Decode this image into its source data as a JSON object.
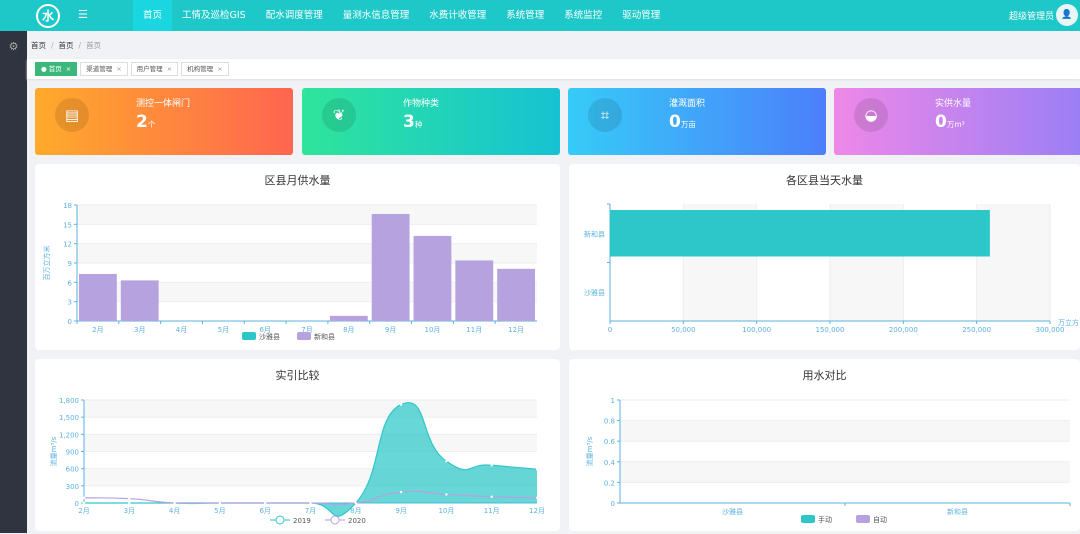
{
  "header": {
    "logo": "水",
    "menu_icon": "indent-icon",
    "nav": [
      "首页",
      "工情及巡检GIS",
      "配水调度管理",
      "量测水信息管理",
      "水费计收管理",
      "系统管理",
      "系统监控",
      "驱动管理"
    ],
    "user": "超级管理员"
  },
  "sidebar": {
    "icon": "gear-icon"
  },
  "breadcrumb": [
    "首页",
    "首页",
    "首页"
  ],
  "tabs": [
    {
      "label": "首页",
      "close": "×"
    },
    {
      "label": "渠道管理",
      "close": "×"
    },
    {
      "label": "用户管理",
      "close": "×"
    },
    {
      "label": "机构管理",
      "close": "×"
    }
  ],
  "cards": [
    {
      "label": "测控一体闸门",
      "value": "2",
      "unit": "个",
      "icon": "gate-icon",
      "colors": [
        "#ffaa2b",
        "#ff6650"
      ]
    },
    {
      "label": "作物种类",
      "value": "3",
      "unit": "种",
      "icon": "leaf-icon",
      "colors": [
        "#2fe59b",
        "#16c2d3"
      ]
    },
    {
      "label": "灌溉面积",
      "value": "0",
      "unit": "万亩",
      "icon": "area-icon",
      "colors": [
        "#36cbf8",
        "#4c7ffb"
      ]
    },
    {
      "label": "实供水量",
      "value": "0",
      "unit": "万m³",
      "icon": "water-bucket-icon",
      "colors": [
        "#ee88e8",
        "#9a7ff5"
      ]
    }
  ],
  "chart_data": [
    {
      "type": "bar",
      "title": "区县月供水量",
      "ylabel": "百万立方米",
      "ylim": [
        0,
        18
      ],
      "yticks": [
        "0",
        "3",
        "6",
        "9",
        "12",
        "15",
        "18"
      ],
      "categories": [
        "2月",
        "3月",
        "4月",
        "5月",
        "6月",
        "7月",
        "8月",
        "9月",
        "10月",
        "11月",
        "12月"
      ],
      "series": [
        {
          "name": "沙雅县",
          "color": "#2ec7c9",
          "values": [
            0,
            0,
            0,
            0,
            0,
            0,
            0,
            0,
            0,
            0,
            0
          ]
        },
        {
          "name": "新和县",
          "color": "#b6a2de",
          "values": [
            7.3,
            6.3,
            0,
            0,
            0,
            0,
            0.8,
            16.6,
            13.2,
            9.4,
            8.1
          ]
        }
      ]
    },
    {
      "type": "bar",
      "orientation": "horizontal",
      "title": "各区县当天水量",
      "xlabel": "万立方",
      "xlim": [
        0,
        300000
      ],
      "xticks": [
        "0",
        "50,000",
        "100,000",
        "150,000",
        "200,000",
        "250,000",
        "300,000"
      ],
      "categories": [
        "新和县",
        "沙雅县"
      ],
      "values": [
        259000,
        0
      ],
      "color": "#2ec7c9"
    },
    {
      "type": "area",
      "title": "实引比较",
      "ylabel": "流量m³/s",
      "ylim": [
        0,
        1800
      ],
      "yticks": [
        "0",
        "300",
        "600",
        "900",
        "1,200",
        "1,500",
        "1,800"
      ],
      "categories": [
        "2月",
        "3月",
        "4月",
        "5月",
        "6月",
        "7月",
        "8月",
        "9月",
        "10月",
        "11月",
        "12月"
      ],
      "series": [
        {
          "name": "2019",
          "color": "#2ec7c9",
          "values": [
            0,
            0,
            0,
            0,
            0,
            0,
            0,
            1720,
            730,
            660,
            590
          ]
        },
        {
          "name": "2020",
          "color": "#b6a2de",
          "values": [
            90,
            75,
            0,
            0,
            0,
            0,
            0,
            190,
            150,
            110,
            90
          ]
        }
      ]
    },
    {
      "type": "bar",
      "title": "用水对比",
      "ylabel": "流量m³/s",
      "ylim": [
        0,
        1
      ],
      "yticks": [
        "0",
        "0.2",
        "0.4",
        "0.6",
        "0.8",
        "1"
      ],
      "categories": [
        "沙雅县",
        "新和县"
      ],
      "series": [
        {
          "name": "手动",
          "color": "#2ec7c9",
          "values": [
            0,
            0
          ]
        },
        {
          "name": "自动",
          "color": "#b6a2de",
          "values": [
            0,
            0
          ]
        }
      ]
    }
  ]
}
